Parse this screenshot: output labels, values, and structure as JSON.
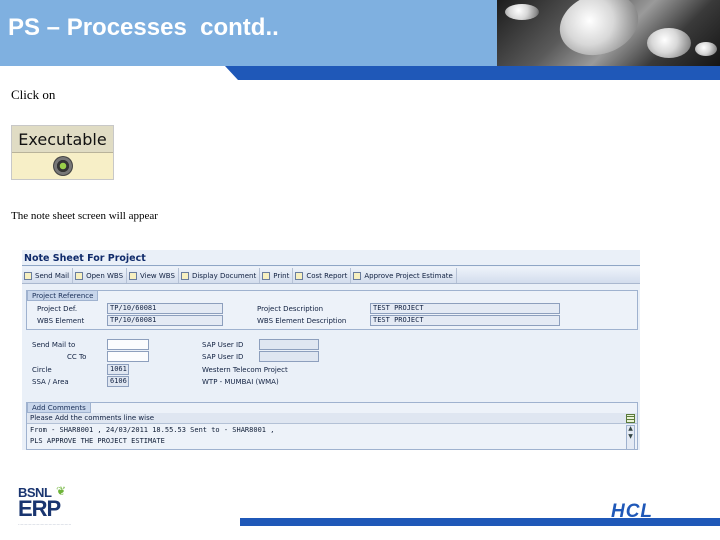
{
  "slide": {
    "title": "PS – Processes  contd..",
    "instruction_1": "Click on",
    "instruction_2": "The note sheet screen will appear"
  },
  "executable_button": {
    "label": "Executable",
    "icon": "execute-gear-icon"
  },
  "sap_screen": {
    "title": "Note Sheet For Project",
    "toolbar": [
      {
        "label": "Send Mail",
        "icon": "mail-icon"
      },
      {
        "label": "Open WBS",
        "icon": "open-icon"
      },
      {
        "label": "View WBS",
        "icon": "view-icon"
      },
      {
        "label": "Display Document",
        "icon": "document-icon"
      },
      {
        "label": "Print",
        "icon": "print-icon"
      },
      {
        "label": "Cost Report",
        "icon": "report-icon"
      },
      {
        "label": "Approve Project Estimate",
        "icon": "approve-icon"
      }
    ],
    "project_reference": {
      "title": "Project Reference",
      "project_def_label": "Project Def.",
      "project_def_value": "TP/10/60081",
      "wbs_element_label": "WBS Element",
      "wbs_element_value": "TP/10/60081",
      "project_description_label": "Project Description",
      "project_description_value": "TEST PROJECT",
      "wbs_element_description_label": "WBS Element Description",
      "wbs_element_description_value": "TEST PROJECT"
    },
    "mail": {
      "send_mail_to_label": "Send Mail to",
      "send_mail_to_value": "",
      "cc_to_label": "CC To",
      "cc_to_value": "",
      "sap_user_id_label_1": "SAP User ID",
      "sap_user_id_value_1": "",
      "sap_user_id_label_2": "SAP User ID",
      "sap_user_id_value_2": "",
      "circle_label": "Circle",
      "circle_value": "1061",
      "circle_name": "Western Telecom Project",
      "ssa_area_label": "SSA / Area",
      "ssa_area_value": "6106",
      "ssa_area_name": "WTP - MUMBAI (WMA)"
    },
    "comments": {
      "title": "Add Comments",
      "header": "Please Add the comments line wise",
      "lines": [
        "From - SHAR8001 , 24/03/2011 18.55.53 Sent to - SHAR8001 ,",
        "PLS APPROVE THE PROJECT ESTIMATE"
      ]
    }
  },
  "footer": {
    "bsnl_logo_text": "BSNL",
    "erp_logo_text": "ERP",
    "hcl_logo_text": "HCL"
  },
  "colors": {
    "header_bg": "#7fb0e0",
    "band": "#1f58b8",
    "sap_bg": "#eaf0f8"
  }
}
